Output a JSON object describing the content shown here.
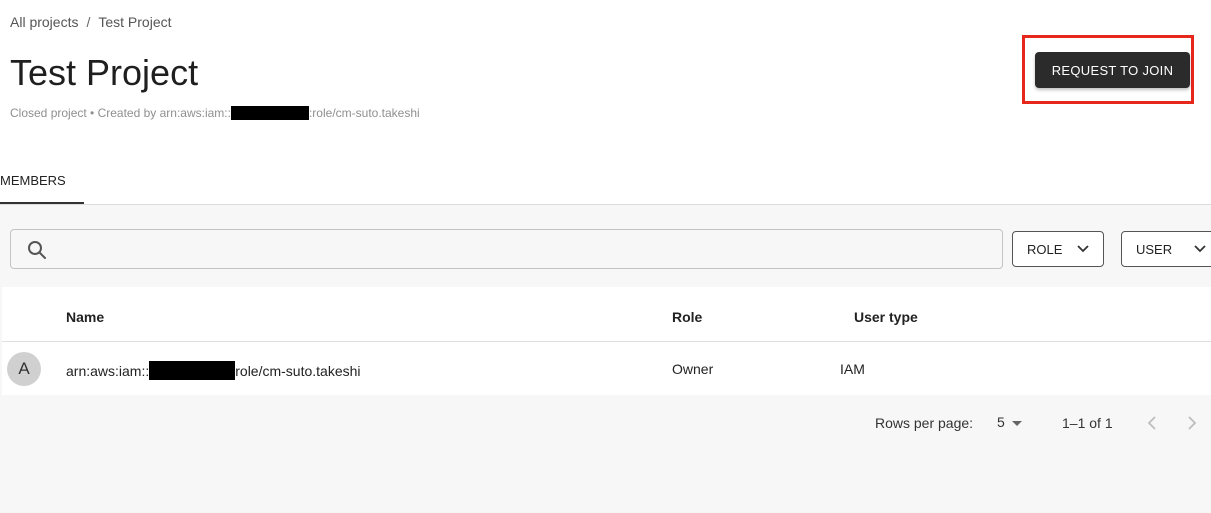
{
  "breadcrumb": {
    "root": "All projects",
    "separator": "/",
    "current": "Test Project"
  },
  "page": {
    "title": "Test Project",
    "subtitle_prefix": "Closed project • Created by arn:aws:iam::",
    "subtitle_suffix": ":role/cm-suto.takeshi"
  },
  "actions": {
    "request_join_label": "REQUEST TO JOIN"
  },
  "tabs": [
    {
      "label": "MEMBERS",
      "active": true
    }
  ],
  "search": {
    "icon": "search-icon",
    "placeholder": ""
  },
  "filters": {
    "role_label": "ROLE",
    "user_label": "USER"
  },
  "table": {
    "columns": [
      "Name",
      "Role",
      "User type"
    ],
    "rows": [
      {
        "avatar": "A",
        "name_prefix": "arn:aws:iam::",
        "name_suffix": "role/cm-suto.takeshi",
        "role": "Owner",
        "user_type": "IAM"
      }
    ]
  },
  "pagination": {
    "rows_per_page_label": "Rows per page:",
    "rows_per_page_value": "5",
    "range": "1–1 of 1"
  },
  "colors": {
    "highlight": "#e8271c",
    "button_bg": "#2b2b2b",
    "content_bg": "#f7f7f7"
  }
}
